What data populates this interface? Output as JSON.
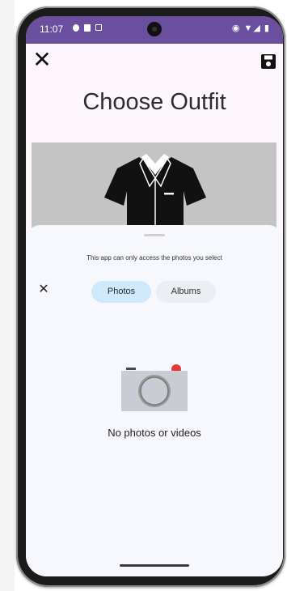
{
  "status_bar": {
    "time": "11:07",
    "right_icons": "◉ ▼◢ ▮"
  },
  "header": {
    "close_icon": "close-icon",
    "save_icon": "floppy-disk-icon",
    "title": "Choose Outfit"
  },
  "preview": {
    "image": "shirt-icon"
  },
  "picker": {
    "notice": "This app can only access the photos you select",
    "close_label": "✕",
    "tabs": [
      {
        "label": "Photos",
        "selected": true
      },
      {
        "label": "Albums",
        "selected": false
      }
    ],
    "empty_icon": "camera-icon",
    "empty_text": "No photos or videos"
  },
  "colors": {
    "status_bar": "#6a4f9f",
    "selected_tab": "#cfe9fa",
    "unselected_tab": "#eceef3",
    "camera_dot": "#e53935"
  }
}
